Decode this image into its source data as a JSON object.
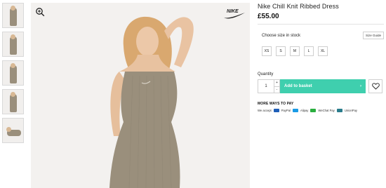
{
  "product": {
    "title": "Nike Chill Knit Ribbed Dress",
    "price": "£55.00"
  },
  "gallery": {
    "thumbnails": [
      "front",
      "side",
      "full-length",
      "back",
      "seated"
    ],
    "brand": "NIKE"
  },
  "size_selector": {
    "label": "Choose size in stock",
    "guide_label": "Size Guide",
    "sizes": [
      "XS",
      "S",
      "M",
      "L",
      "XL"
    ]
  },
  "purchase": {
    "quantity_label": "Quantity",
    "quantity_value": "1",
    "increment_symbol": "+",
    "decrement_symbol": "-",
    "add_label": "Add to basket",
    "add_arrow": "›"
  },
  "payments": {
    "title": "MORE WAYS TO PAY",
    "accept_label": "We accept",
    "methods": [
      {
        "name": "PayPal",
        "color": "#1f5fb8"
      },
      {
        "name": "Alipay",
        "color": "#1a9be6"
      },
      {
        "name": "WeChat Pay",
        "color": "#2aae3f"
      },
      {
        "name": "UnionPay",
        "color": "#2a7c8c"
      }
    ]
  },
  "colors": {
    "accent": "#3fcfae",
    "dress": "#9a8f7c"
  }
}
